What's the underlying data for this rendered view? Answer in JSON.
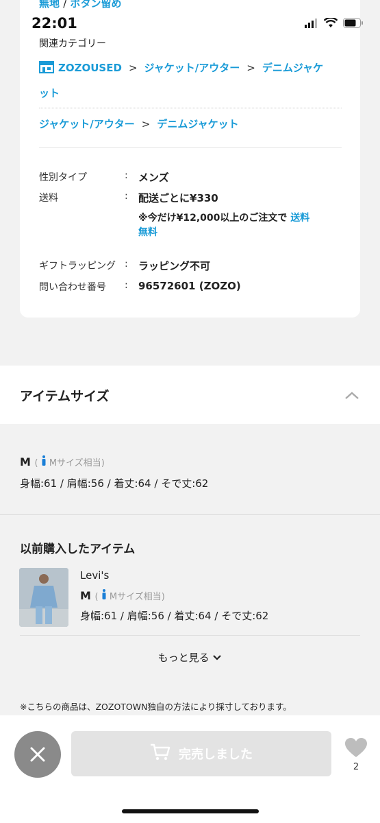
{
  "status_bar": {
    "time": "22:01"
  },
  "top_partial_link": {
    "part1": "無地",
    "separator": "/",
    "part2": "ボタン留め"
  },
  "related": {
    "label": "関連カテゴリー",
    "crumb1": {
      "shop": "ZOZOUSED",
      "cat": "ジャケット/アウター",
      "sub_line1": "デニムジャケ",
      "sub_line2": "ット"
    },
    "crumb2": {
      "cat": "ジャケット/アウター",
      "sub": "デニムジャケット"
    },
    "gt": ">"
  },
  "specs": {
    "colon": ":",
    "gender_label": "性別タイプ",
    "gender_value": "メンズ",
    "shipping_label": "送料",
    "shipping_value": "配送ごとに¥330",
    "shipping_note": "※今だけ¥12,000以上のご注文で",
    "shipping_note_link_a": "送料",
    "shipping_note_link_b": "無料",
    "gift_label": "ギフトラッピング",
    "gift_value": "ラッピング不可",
    "inquiry_label": "問い合わせ番号",
    "inquiry_value": "96572601 (ZOZO)"
  },
  "item_size": {
    "title": "アイテムサイズ",
    "size": "M",
    "equivalent": "Mサイズ相当",
    "measurements": "身幅:61 / 肩幅:56 / 着丈:64 / そで丈:62"
  },
  "previous": {
    "title": "以前購入したアイテム",
    "brand": "Levi's",
    "size": "M",
    "equivalent": "Mサイズ相当",
    "measurements": "身幅:61 / 肩幅:56 / 着丈:64 / そで丈:62",
    "more": "もっと見る"
  },
  "footnote": "※こちらの商品は、ZOZOTOWN独自の方法により採寸しております。",
  "bottom": {
    "soldout": "完売しました",
    "fav_count": "2"
  },
  "colors": {
    "link": "#1a9bd7",
    "disabled_button": "#e3e3e3",
    "close_button": "#8a8a8a",
    "heart": "#bdbdbd"
  }
}
